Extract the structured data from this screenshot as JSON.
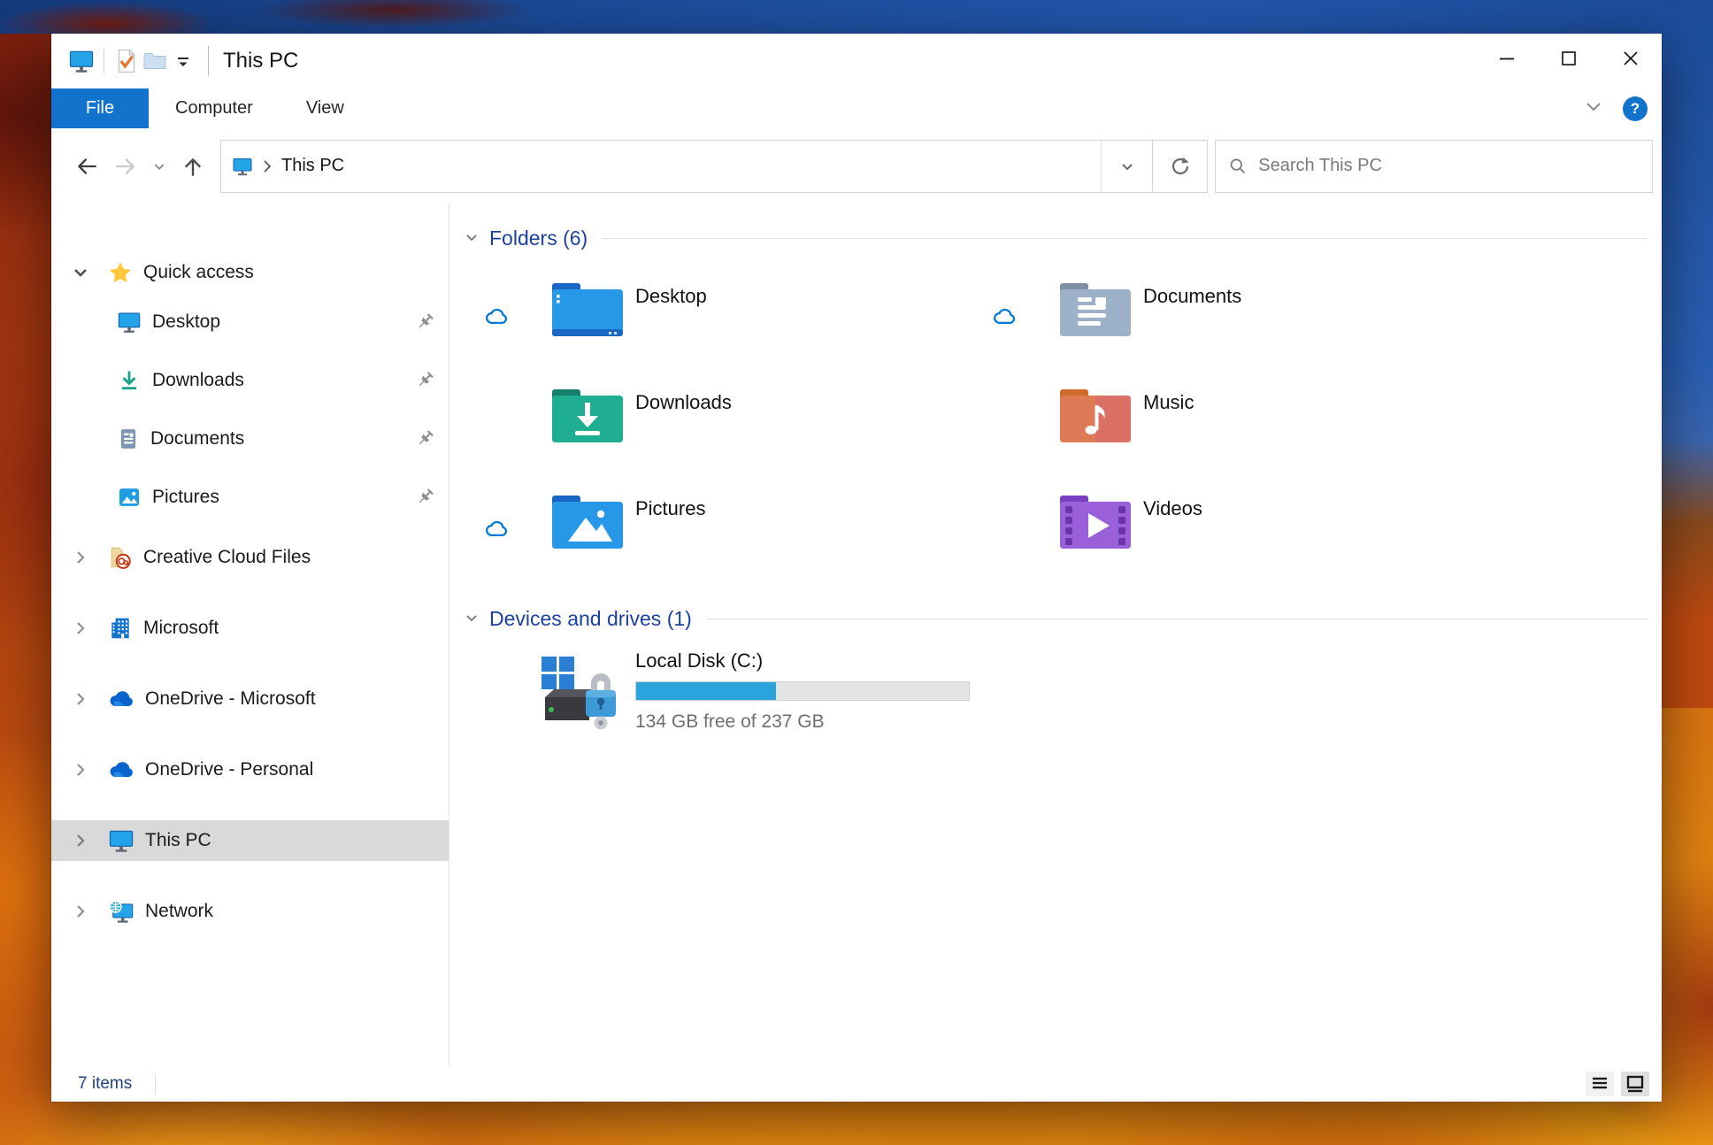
{
  "colors": {
    "accent": "#1273cc",
    "section_header_blue": "#1c419f",
    "progress_fill": "#2ba3dc",
    "onedrive_blue": "#0a64cf",
    "selection_gray": "#d9d9d9"
  },
  "window": {
    "title": "This PC",
    "help_glyph": "?"
  },
  "menu": {
    "file": "File",
    "computer": "Computer",
    "view": "View"
  },
  "toolbar": {
    "address_location": "This PC",
    "search_placeholder": "Search This PC"
  },
  "sidebar": {
    "items": [
      {
        "label": "Quick access"
      },
      {
        "label": "Desktop",
        "pinned": true
      },
      {
        "label": "Downloads",
        "pinned": true
      },
      {
        "label": "Documents",
        "pinned": true
      },
      {
        "label": "Pictures",
        "pinned": true
      },
      {
        "label": "Creative Cloud Files"
      },
      {
        "label": "Microsoft"
      },
      {
        "label": "OneDrive - Microsoft"
      },
      {
        "label": "OneDrive - Personal"
      },
      {
        "label": "This PC",
        "selected": true
      },
      {
        "label": "Network"
      }
    ]
  },
  "content": {
    "folders_section": {
      "title": "Folders (6)",
      "tiles": [
        {
          "label": "Desktop",
          "cloud": true
        },
        {
          "label": "Documents",
          "cloud": true
        },
        {
          "label": "Downloads",
          "cloud": false
        },
        {
          "label": "Music",
          "cloud": false
        },
        {
          "label": "Pictures",
          "cloud": true
        },
        {
          "label": "Videos",
          "cloud": false
        }
      ]
    },
    "devices_section": {
      "title": "Devices and drives (1)",
      "drive": {
        "name": "Local Disk (C:)",
        "free_text": "134 GB free of 237 GB",
        "used_percent": 42
      }
    }
  },
  "statusbar": {
    "items_text": "7 items"
  }
}
